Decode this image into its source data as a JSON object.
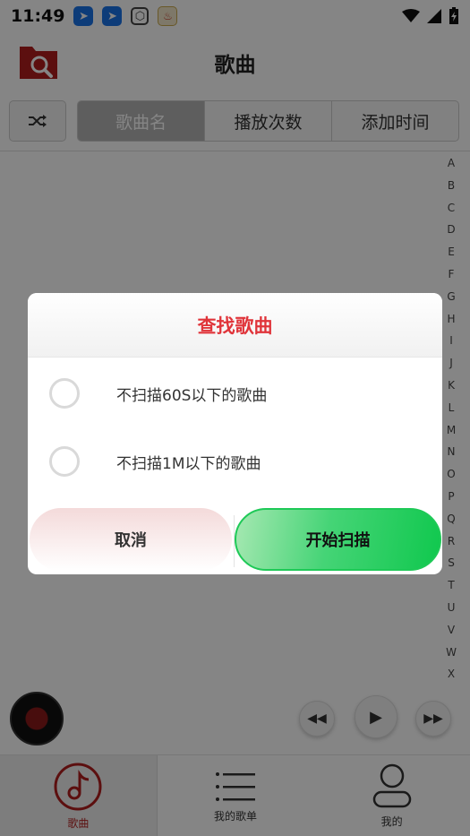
{
  "status_bar": {
    "time": "11:49",
    "notifications": [
      "blue-app-icon",
      "blue-app-icon",
      "package-icon",
      "food-app-icon"
    ],
    "system_icons": [
      "wifi-icon",
      "signal-icon",
      "battery-charging-icon"
    ]
  },
  "header": {
    "title": "歌曲",
    "left_icon": "folder-search-icon"
  },
  "sort_tabs": [
    {
      "label": "歌曲名",
      "active": true
    },
    {
      "label": "播放次数",
      "active": false
    },
    {
      "label": "添加时间",
      "active": false
    }
  ],
  "alphabet": [
    "A",
    "B",
    "C",
    "D",
    "E",
    "F",
    "G",
    "H",
    "I",
    "J",
    "K",
    "L",
    "M",
    "N",
    "O",
    "P",
    "Q",
    "R",
    "S",
    "T",
    "U",
    "V",
    "W",
    "X"
  ],
  "bottom_nav": [
    {
      "label": "歌曲",
      "icon": "music-note-icon",
      "active": true
    },
    {
      "label": "我的歌单",
      "icon": "list-icon",
      "active": false
    },
    {
      "label": "我的",
      "icon": "user-icon",
      "active": false
    }
  ],
  "dialog": {
    "title": "查找歌曲",
    "options": [
      {
        "label": "不扫描60S以下的歌曲",
        "checked": false
      },
      {
        "label": "不扫描1M以下的歌曲",
        "checked": false
      }
    ],
    "cancel_label": "取消",
    "confirm_label": "开始扫描"
  },
  "colors": {
    "accent_red": "#e0343a",
    "brand_red": "#b01e1e",
    "confirm_green": "#10c84e"
  }
}
